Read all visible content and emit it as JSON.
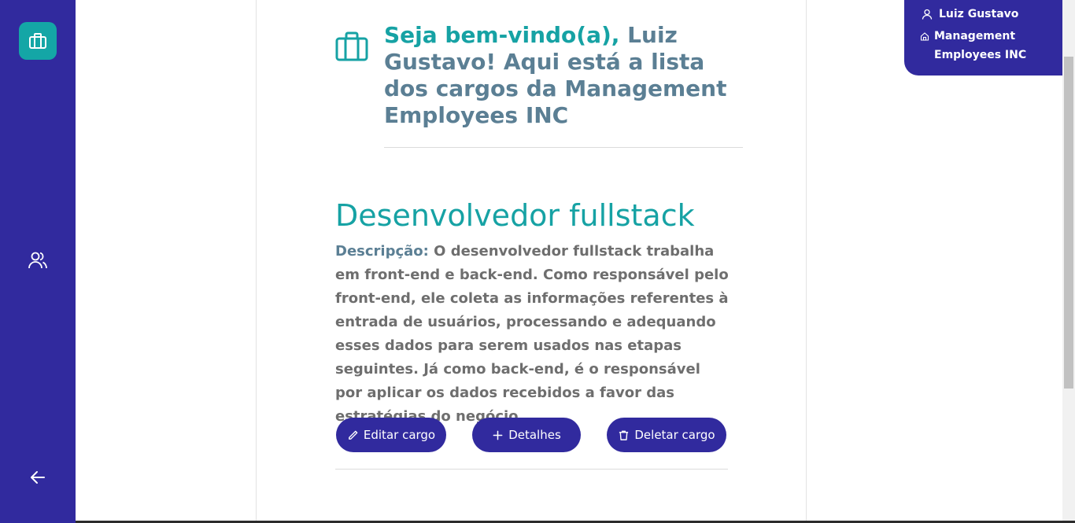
{
  "sidebar": {
    "items": [
      {
        "icon": "briefcase-icon",
        "active": true
      },
      {
        "icon": "users-icon"
      },
      {
        "icon": "arrow-left-icon"
      }
    ]
  },
  "header": {
    "greeting_prefix": "Seja bem-vindo(a),",
    "greeting_rest": " Luiz Gustavo! Aqui está a lista dos cargos da Management Employees INC"
  },
  "job": {
    "title": "Desenvolvedor fullstack",
    "description_label": "Descripção:",
    "description": " O desenvolvedor fullstack trabalha em front-end e back-end. Como responsável pelo front-end, ele coleta as informações referentes à entrada de usuários, processando e adequando esses dados para serem usados nas etapas seguintes. Já como back-end, é o responsável por aplicar os dados recebidos a favor das estratégias do negócio.",
    "actions": {
      "edit": "Editar cargo",
      "details": "Detalhes",
      "delete": "Deletar cargo"
    }
  },
  "user_panel": {
    "user_name": "Luiz Gustavo",
    "company": "Management Employees INC"
  },
  "colors": {
    "primary": "#312a9e",
    "accent": "#16a2a4",
    "muted": "#5b7f94"
  }
}
